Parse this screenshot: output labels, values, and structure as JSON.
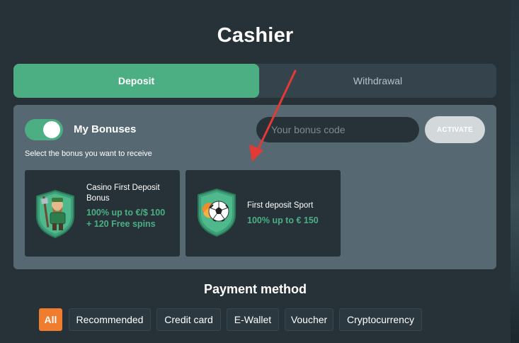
{
  "modal": {
    "title": "Cashier"
  },
  "tabs": [
    {
      "label": "Deposit",
      "active": true
    },
    {
      "label": "Withdrawal",
      "active": false
    }
  ],
  "bonuses": {
    "toggle_label": "My Bonuses",
    "toggle_on": true,
    "code_placeholder": "Your bonus code",
    "code_value": "",
    "activate_label": "ACTIVATE",
    "hint": "Select the bonus you want to receive",
    "cards": [
      {
        "name": "Casino First Deposit Bonus",
        "offer": "100% up to €/$ 100 + 120 Free spins",
        "icon": "lumberjack-shield-icon"
      },
      {
        "name": "First deposit Sport",
        "offer": "100% up to € 150",
        "icon": "soccer-ball-shield-icon"
      }
    ]
  },
  "payment": {
    "title": "Payment method",
    "filters": [
      {
        "label": "All",
        "active": true
      },
      {
        "label": "Recommended",
        "active": false
      },
      {
        "label": "Credit card",
        "active": false
      },
      {
        "label": "E-Wallet",
        "active": false
      },
      {
        "label": "Voucher",
        "active": false
      },
      {
        "label": "Cryptocurrency",
        "active": false
      }
    ]
  },
  "colors": {
    "accent_green": "#4caf84",
    "accent_orange": "#f07d2e",
    "annotation_arrow": "#e53935"
  }
}
